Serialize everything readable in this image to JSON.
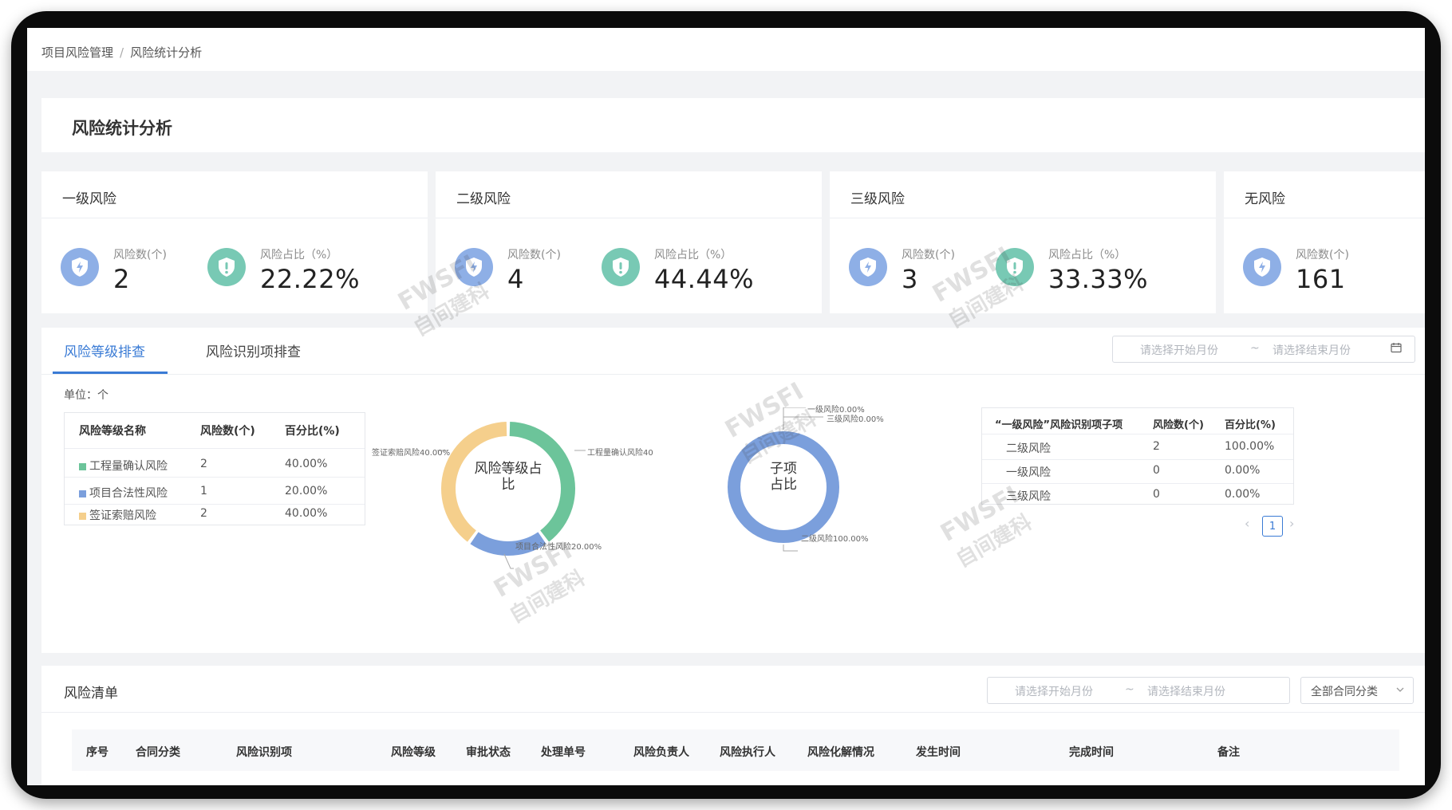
{
  "breadcrumb": [
    "项目风险管理",
    "风险统计分析"
  ],
  "breadcrumb_sep": "/",
  "page_title": "风险统计分析",
  "stat_cards": [
    {
      "title": "一级风险",
      "count_label": "风险数(个)",
      "count": "2",
      "ratio_label": "风险占比（%）",
      "ratio": "22.22%"
    },
    {
      "title": "二级风险",
      "count_label": "风险数(个)",
      "count": "4",
      "ratio_label": "风险占比（%）",
      "ratio": "44.44%"
    },
    {
      "title": "三级风险",
      "count_label": "风险数(个)",
      "count": "3",
      "ratio_label": "风险占比（%）",
      "ratio": "33.33%"
    },
    {
      "title": "无风险",
      "count_label": "风险数(个)",
      "count": "161"
    }
  ],
  "tabs": [
    "风险等级排查",
    "风险识别项排查"
  ],
  "active_tab": 0,
  "date_range": {
    "start_placeholder": "请选择开始月份",
    "sep": "~",
    "end_placeholder": "请选择结束月份"
  },
  "unit_label": "单位：个",
  "level_table": {
    "headers": [
      "风险等级名称",
      "风险数(个)",
      "百分比(%)"
    ],
    "rows": [
      {
        "name": "工程量确认风险",
        "count": "2",
        "pct": "40.00%",
        "color": "#6cc49a"
      },
      {
        "name": "项目合法性风险",
        "count": "1",
        "pct": "20.00%",
        "color": "#7b9fdc"
      },
      {
        "name": "签证索赔风险",
        "count": "2",
        "pct": "40.00%",
        "color": "#f5cf8c"
      }
    ]
  },
  "sub_table": {
    "headers": [
      "“一级风险”风险识别项子项",
      "风险数(个)",
      "百分比(%)"
    ],
    "rows": [
      {
        "name": "二级风险",
        "count": "2",
        "pct": "100.00%"
      },
      {
        "name": "一级风险",
        "count": "0",
        "pct": "0.00%"
      },
      {
        "name": "三级风险",
        "count": "0",
        "pct": "0.00%"
      }
    ]
  },
  "pagination": {
    "current": "1",
    "prev": "‹",
    "next": "›"
  },
  "chart_data": [
    {
      "type": "pie",
      "title": "风险等级占比",
      "categories": [
        "工程量确认风险",
        "项目合法性风险",
        "签证索赔风险"
      ],
      "values": [
        40,
        20,
        40
      ],
      "colors": [
        "#6cc49a",
        "#7b9fdc",
        "#f5cf8c"
      ],
      "labels": [
        "工程量确认风险40",
        "项目合法性风险20.00%",
        "签证索赔风险40.00%"
      ]
    },
    {
      "type": "pie",
      "title": "子项占比",
      "categories": [
        "二级风险",
        "一级风险",
        "三级风险"
      ],
      "values": [
        100,
        0,
        0
      ],
      "colors": [
        "#7b9fdc",
        "#6cc49a",
        "#f5cf8c"
      ],
      "labels": [
        "二级风险100.00%",
        "一级风险0.00%",
        "三级风险0.00%"
      ]
    }
  ],
  "list": {
    "title": "风险清单",
    "category_select": "全部合同分类",
    "columns": [
      "序号",
      "合同分类",
      "风险识别项",
      "风险等级",
      "审批状态",
      "处理单号",
      "风险负责人",
      "风险执行人",
      "风险化解情况",
      "发生时间",
      "完成时间",
      "备注"
    ]
  },
  "watermark": {
    "brand": "FWSFI",
    "text": "自间建科"
  }
}
